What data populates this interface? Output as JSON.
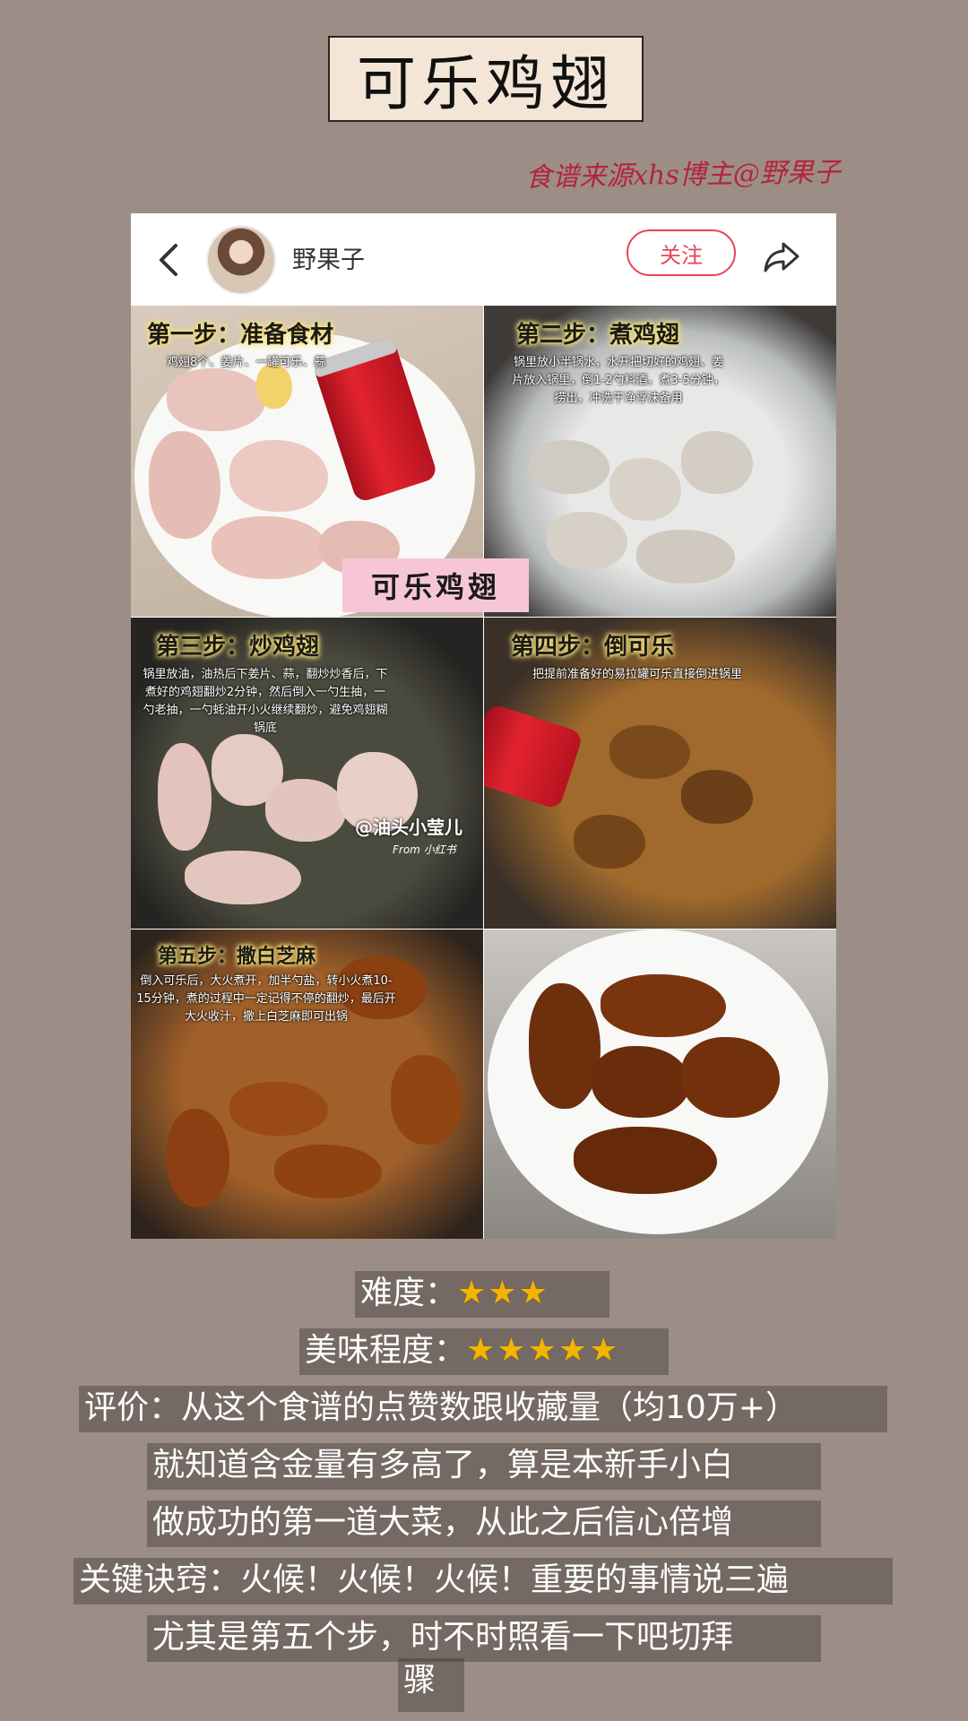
{
  "title": "可乐鸡翅",
  "source_note": "食谱来源xhs博主@野果子",
  "post": {
    "author": "野果子",
    "follow_label": "关注"
  },
  "steps": [
    {
      "title": "第一步：准备食材",
      "text": "鸡翅8个、姜片、一罐可乐、蒜"
    },
    {
      "title": "第二步：煮鸡翅",
      "text": "锅里放小半锅水，水开把切好的鸡翅、姜片放入锅里，倒1-2勺料酒，煮3-5分钟，捞出，冲洗干净浮沫备用"
    },
    {
      "title": "第三步：炒鸡翅",
      "text": "锅里放油，油热后下姜片、蒜，翻炒炒香后，下煮好的鸡翅翻炒2分钟，然后倒入一勺生抽，一勺老抽，一勺蚝油开小火继续翻炒，避免鸡翅糊锅底"
    },
    {
      "title": "第四步：倒可乐",
      "text": "把提前准备好的易拉罐可乐直接倒进锅里"
    },
    {
      "title": "第五步：撒白芝麻",
      "text": "倒入可乐后，大火煮开，加半勺盐，转小火煮10-15分钟，煮的过程中一定记得不停的翻炒，最后开大火收汁，撒上白芝麻即可出锅"
    }
  ],
  "watermark": "@油头小莹儿",
  "watermark_from": "From 小红书",
  "sticker": "可乐鸡翅",
  "ratings": {
    "difficulty_label": "难度：",
    "difficulty_stars": 3,
    "difficulty_stars_text": "★★★",
    "taste_label": "美味程度：",
    "taste_stars": 5,
    "taste_stars_text": "★★★★★"
  },
  "review_lines": [
    "评价：从这个食谱的点赞数跟收藏量（均10万+）",
    "就知道含金量有多高了，算是本新手小白",
    "做成功的第一道大菜，从此之后信心倍增",
    "关键诀窍：火候！火候！火候！重要的事情说三遍",
    "尤其是第五个步，时不时照看一下吧切拜",
    "骤"
  ],
  "colors": {
    "background": "#9c8e86",
    "accent": "#e9435a",
    "source_text": "#b5233c",
    "star": "#f4b400"
  }
}
